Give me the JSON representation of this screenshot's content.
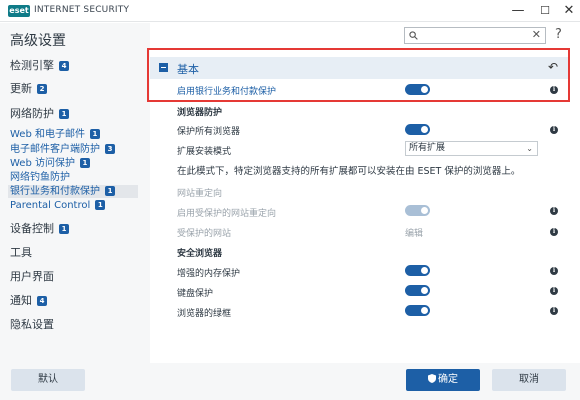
{
  "titlebar": {
    "logo_text": "eset",
    "app_title": "INTERNET SECURITY",
    "minimize": "—",
    "maximize": "☐",
    "close": "✕"
  },
  "sidebar": {
    "title": "高级设置",
    "items": [
      {
        "label": "检测引擎",
        "badge": "4"
      },
      {
        "label": "更新",
        "badge": "2"
      },
      {
        "label": "网络防护",
        "badge": "1"
      }
    ],
    "subitems": [
      {
        "label": "Web 和电子邮件",
        "badge": "1"
      },
      {
        "label": "电子邮件客户端防护",
        "badge": "3"
      },
      {
        "label": "Web 访问保护",
        "badge": "1"
      },
      {
        "label": "网络钓鱼防护",
        "badge": ""
      },
      {
        "label": "银行业务和付款保护",
        "badge": "1"
      },
      {
        "label": "Parental Control",
        "badge": "1"
      }
    ],
    "items2": [
      {
        "label": "设备控制",
        "badge": "1"
      },
      {
        "label": "工具",
        "badge": ""
      },
      {
        "label": "用户界面",
        "badge": ""
      },
      {
        "label": "通知",
        "badge": "4"
      },
      {
        "label": "隐私设置",
        "badge": ""
      }
    ]
  },
  "search": {
    "value": "",
    "placeholder": "",
    "clear": "✕"
  },
  "help": "?",
  "section": {
    "title": "基本",
    "reset": "↶",
    "enable_label": "启用银行业务和付款保护"
  },
  "browser_protection": {
    "heading": "浏览器防护",
    "protect_all_label": "保护所有浏览器",
    "ext_mode_label": "扩展安装模式",
    "ext_mode_value": "所有扩展",
    "note": "在此模式下，特定浏览器支持的所有扩展都可以安装在由 ESET 保护的浏览器上。"
  },
  "redirect": {
    "heading": "网站重定向",
    "enable_label": "启用受保护的网站重定向",
    "sites_label": "受保护的网站",
    "edit": "编辑"
  },
  "secure_browser": {
    "heading": "安全浏览器",
    "memory_label": "增强的内存保护",
    "keyboard_label": "键盘保护",
    "frame_label": "浏览器的绿框"
  },
  "footer": {
    "default": "默认",
    "ok": "确定",
    "cancel": "取消"
  },
  "colors": {
    "accent": "#1d5fa6",
    "highlight": "#e53935",
    "sidebar_bg": "#f6f7f8",
    "section_bg": "#e7eef5"
  }
}
